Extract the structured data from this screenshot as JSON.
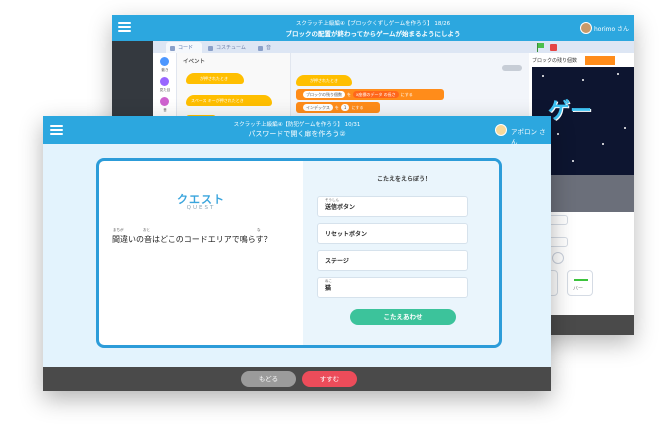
{
  "colors": {
    "header_blue": "#2ca7df",
    "card_border": "#2c9cd9",
    "quest_title": "#3aa5dd",
    "submit_green": "#3cc39b",
    "next_red": "#ec4c5a",
    "back_gray": "#9b9b9b",
    "footer": "#4a4a4a",
    "front_bg": "#e3f3fd"
  },
  "back_window": {
    "header": {
      "line1": "スクラッチ上級編④【ブロックくずしゲームを作ろう】 18/26",
      "line2": "ブロックの配置が終わってからゲームが始まるようにしよう",
      "user": "horimo さん"
    },
    "tabs": [
      "コード",
      "コスチューム",
      "音"
    ],
    "categories": [
      {
        "label": "動き",
        "color": "#4c97ff"
      },
      {
        "label": "見た目",
        "color": "#9966ff"
      },
      {
        "label": "音",
        "color": "#cf63cf"
      }
    ],
    "palette": {
      "title": "イベント",
      "block1": "が押されたとき",
      "block2": "スペース キーが押されたとき"
    },
    "script": {
      "hat": "が押されたとき",
      "line1_a": "ブロックの残り個数",
      "line1_b": "を",
      "line1_c": "x座標のデータ",
      "line1_d": "の長さ",
      "line1_e": "にする",
      "line2_a": "インデックス",
      "line2_b": "を",
      "line2_val": "1",
      "line2_c": "にする"
    },
    "stage": {
      "title": "ブロックの残り個数",
      "game_text": "ゲー"
    },
    "sprite_labels": [
      "バー"
    ]
  },
  "front_window": {
    "header": {
      "line1": "スクラッチ上級編④【防犯ゲームを作ろう】 10/31",
      "line2": "パスワードで開く扉を作ろう②",
      "user": "アポロン さん"
    },
    "quest": {
      "title": "クエスト",
      "subtitle": "QUEST",
      "furigana": [
        "まちが",
        "おと",
        "な"
      ],
      "question": "間違いの音はどこのコードエリアで鳴らす？"
    },
    "answer": {
      "heading": "こたえをえらぼう！",
      "options": [
        {
          "label": "送信ボタン",
          "furigana": "そうしん"
        },
        {
          "label": "リセットボタン",
          "furigana": ""
        },
        {
          "label": "ステージ",
          "furigana": ""
        },
        {
          "label": "猫",
          "furigana": "ねこ"
        }
      ],
      "submit": "こたえあわせ"
    },
    "footer": {
      "back": "もどる",
      "next": "すすむ"
    }
  }
}
